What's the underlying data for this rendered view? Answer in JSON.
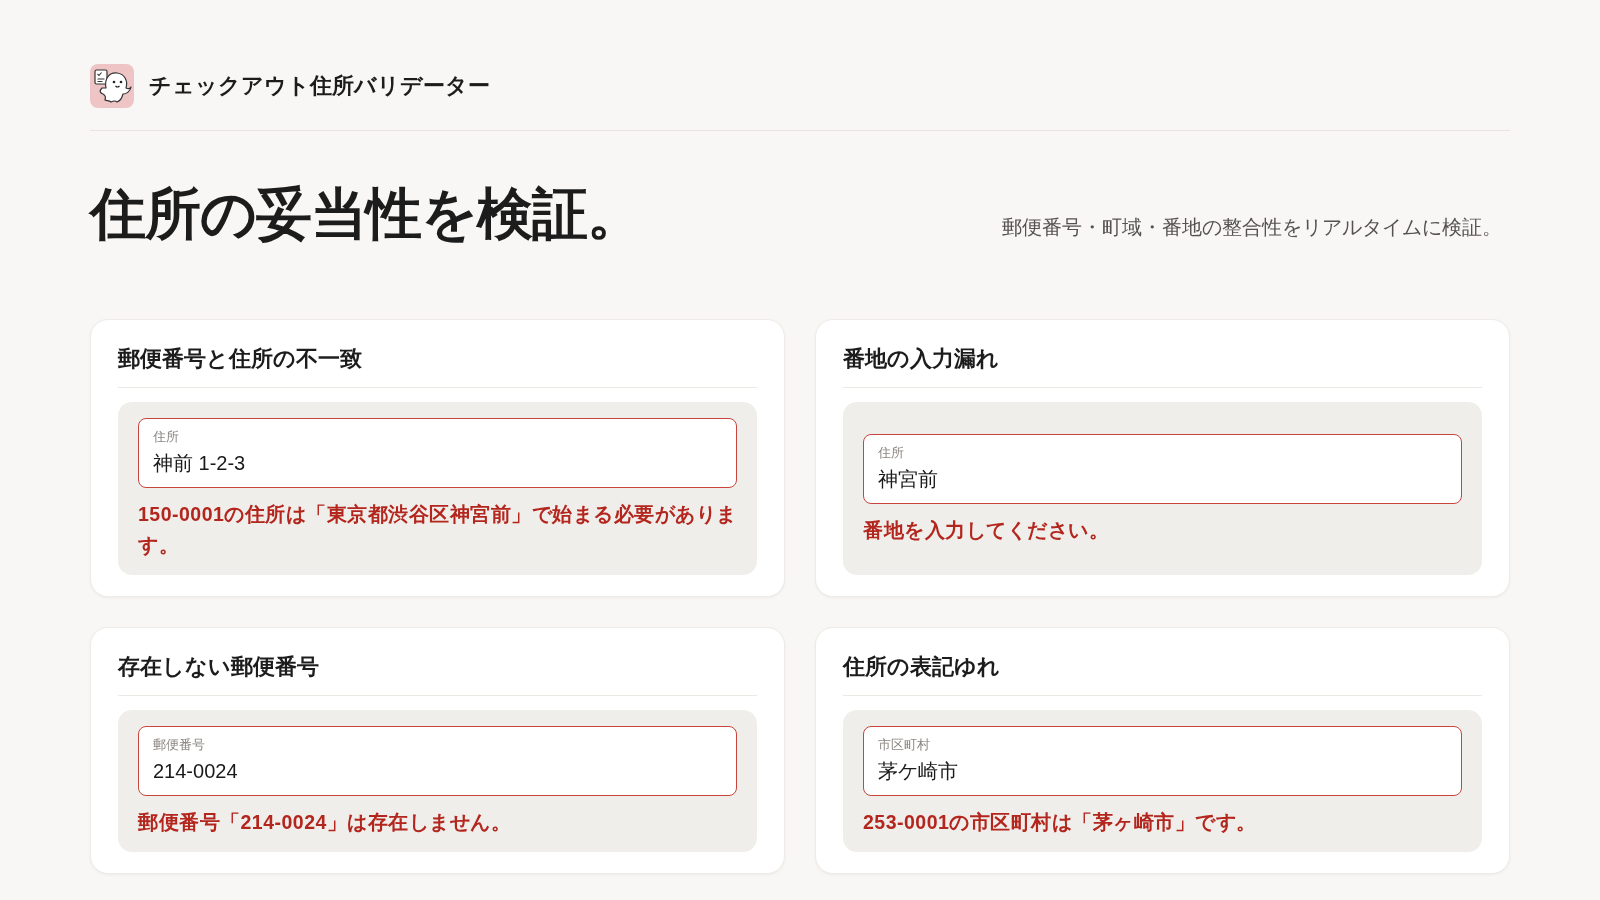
{
  "header": {
    "app_name": "チェックアウト住所バリデーター"
  },
  "hero": {
    "title": "住所の妥当性を検証。",
    "subtitle": "郵便番号・町域・番地の整合性をリアルタイムに検証。"
  },
  "cards": [
    {
      "title": "郵便番号と住所の不一致",
      "field": {
        "label": "住所",
        "value": "神前 1-2-3",
        "invalid": true
      },
      "error": "150-0001の住所は「東京都渋谷区神宮前」で始まる必要があります。"
    },
    {
      "title": "番地の入力漏れ",
      "field": {
        "label": "住所",
        "value": "神宮前",
        "invalid": true
      },
      "error": "番地を入力してください。"
    },
    {
      "title": "存在しない郵便番号",
      "field": {
        "label": "郵便番号",
        "value": "214-0024",
        "invalid": true
      },
      "error": "郵便番号「214-0024」は存在しません。"
    },
    {
      "title": "住所の表記ゆれ",
      "field": {
        "label": "市区町村",
        "value": "茅ケ崎市",
        "invalid": true
      },
      "error": "253-0001の市区町村は「茅ヶ崎市」です。"
    }
  ]
}
